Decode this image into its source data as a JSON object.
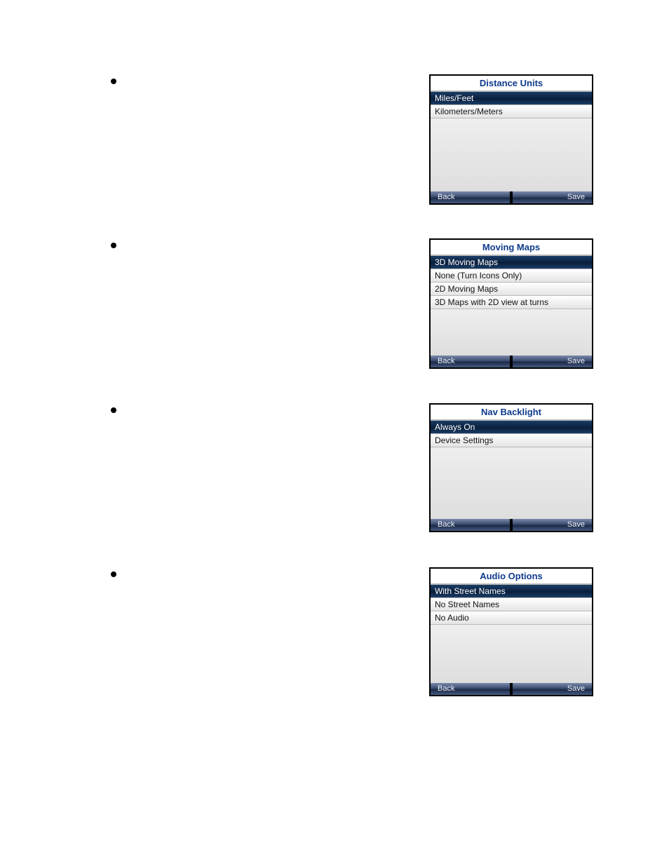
{
  "panels": [
    {
      "title": "Distance Units",
      "selectedIndex": 0,
      "options": [
        "Miles/Feet",
        "Kilometers/Meters"
      ],
      "back": "Back",
      "save": "Save"
    },
    {
      "title": "Moving Maps",
      "selectedIndex": 0,
      "options": [
        "3D Moving Maps",
        "None (Turn Icons Only)",
        "2D Moving Maps",
        "3D Maps with 2D view at turns"
      ],
      "back": "Back",
      "save": "Save"
    },
    {
      "title": "Nav Backlight",
      "selectedIndex": 0,
      "options": [
        "Always On",
        "Device Settings"
      ],
      "back": "Back",
      "save": "Save"
    },
    {
      "title": "Audio Options",
      "selectedIndex": 0,
      "options": [
        "With Street Names",
        "No Street Names",
        "No Audio"
      ],
      "back": "Back",
      "save": "Save"
    }
  ]
}
